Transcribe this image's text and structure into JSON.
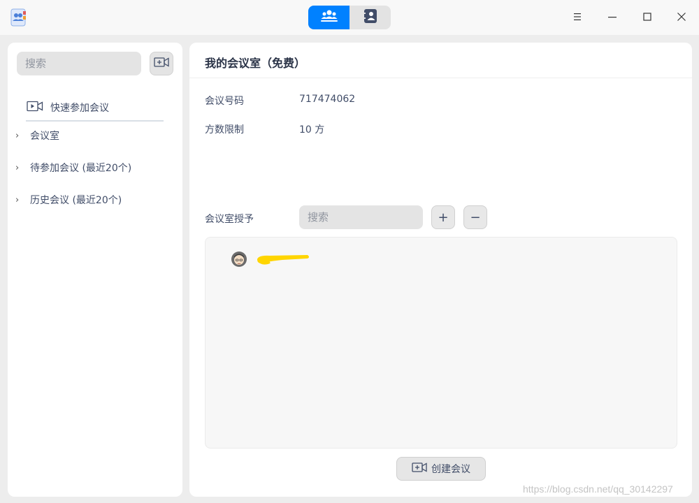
{
  "titlebar": {
    "app_icon": "address-book-icon",
    "mode_tabs": [
      {
        "icon": "group-meeting-icon",
        "active": true
      },
      {
        "icon": "contact-card-icon",
        "active": false
      }
    ],
    "window_controls": [
      "menu-icon",
      "minimize-icon",
      "maximize-icon",
      "close-icon"
    ]
  },
  "sidebar": {
    "search_placeholder": "搜索",
    "quick_join_label": "快速参加会议",
    "items": [
      {
        "label": "会议室"
      },
      {
        "label": "待参加会议 (最近20个)"
      },
      {
        "label": "历史会议 (最近20个)"
      }
    ]
  },
  "main": {
    "title": "我的会议室（免费）",
    "meeting_number_label": "会议号码",
    "meeting_number_value": "717474062",
    "participant_limit_label": "方数限制",
    "participant_limit_value": "10 方",
    "grant_label": "会议室授予",
    "grant_search_placeholder": "搜索",
    "add_label": "+",
    "remove_label": "−",
    "create_button_label": "创建会议"
  },
  "watermark": "https://blog.csdn.net/qq_30142297",
  "colors": {
    "accent": "#0081ff",
    "text": "#414d68",
    "redaction": "#ffd500"
  }
}
